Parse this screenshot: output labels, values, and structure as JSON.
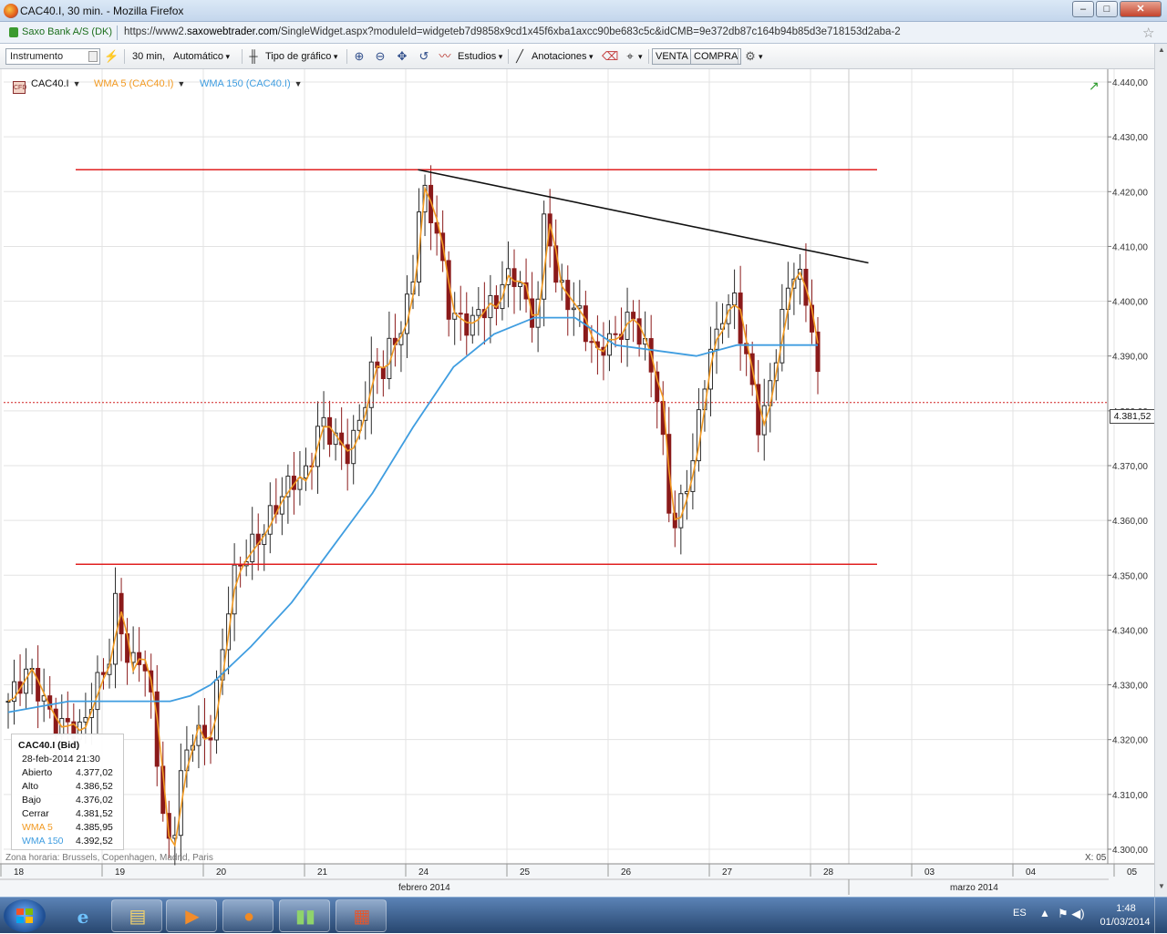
{
  "window": {
    "title": "CAC40.I, 30 min. - Mozilla Firefox",
    "controls": [
      "–",
      "□",
      "✕"
    ]
  },
  "urlbar": {
    "site_identity": "Saxo Bank A/S (DK)",
    "url_prefix": "https://www2.",
    "url_domain": "saxowebtrader.com",
    "url_rest": "/SingleWidget.aspx?moduleId=widgeteb7d9858x9cd1x45f6xba1axcc90be683c5c&idCMB=9e372db87c164b94b85d3e718153d2aba-2"
  },
  "toolbar": {
    "instrument_placeholder": "Instrumento",
    "interval": "30 min",
    "scale": "Automático",
    "chart_type": "Tipo de gráfico",
    "studies": "Estudios",
    "annotations": "Anotaciones",
    "sell": "VENTA",
    "buy": "COMPRA"
  },
  "legend": {
    "instrument": "CAC40.I",
    "wma5": "WMA 5 (CAC40.I)",
    "wma150": "WMA 150 (CAC40.I)",
    "cfd_badge": "CFD"
  },
  "colors": {
    "wma5": "#f29a22",
    "wma150": "#3f9de0",
    "candle_up": "#2b2b2b",
    "candle_down": "#8b1a1a",
    "horizontal_lines": "#e02020",
    "trendline": "#111111",
    "last_price_line": "#d02020"
  },
  "infobox": {
    "title": "CAC40.I (Bid)",
    "datetime": "28-feb-2014  21:30",
    "rows": [
      {
        "label": "Abierto",
        "value": "4.377,02"
      },
      {
        "label": "Alto",
        "value": "4.386,52"
      },
      {
        "label": "Bajo",
        "value": "4.376,02"
      },
      {
        "label": "Cerrar",
        "value": "4.381,52"
      },
      {
        "label": "WMA 5",
        "value": "4.385,95"
      },
      {
        "label": "WMA 150",
        "value": "4.392,52"
      }
    ]
  },
  "timezone": "Zona horaria: Brussels, Copenhagen, Madrid, Paris",
  "xcoord": "X: 05",
  "last_price": "4.381,52",
  "chart_data": {
    "type": "line",
    "instrument": "CAC40.I",
    "interval": "30 min",
    "y_ticks": [
      "4.440,00",
      "4.430,00",
      "4.420,00",
      "4.410,00",
      "4.400,00",
      "4.390,00",
      "4.380,00",
      "4.370,00",
      "4.360,00",
      "4.350,00",
      "4.340,00",
      "4.330,00",
      "4.320,00",
      "4.310,00",
      "4.300,00"
    ],
    "ylim": [
      4297,
      4442
    ],
    "x_day_labels": [
      "18",
      "19",
      "20",
      "21",
      "24",
      "25",
      "26",
      "27",
      "28",
      "03",
      "04",
      "05"
    ],
    "month_labels": [
      "febrero 2014",
      "marzo 2014"
    ],
    "days": [
      {
        "label": "18",
        "start": 0,
        "end": 1
      },
      {
        "label": "19",
        "start": 1,
        "end": 2
      },
      {
        "label": "20",
        "start": 2,
        "end": 3
      },
      {
        "label": "21",
        "start": 3,
        "end": 4
      },
      {
        "label": "24",
        "start": 4,
        "end": 5
      },
      {
        "label": "25",
        "start": 5,
        "end": 6
      },
      {
        "label": "26",
        "start": 6,
        "end": 7
      },
      {
        "label": "27",
        "start": 7,
        "end": 8
      },
      {
        "label": "28",
        "start": 8,
        "end": 9
      },
      {
        "label": "03",
        "start": 9,
        "end": 10
      },
      {
        "label": "04",
        "start": 10,
        "end": 11
      },
      {
        "label": "05",
        "start": 11,
        "end": 12
      }
    ],
    "price_path": [
      [
        0.0,
        4327
      ],
      [
        0.1,
        4330
      ],
      [
        0.2,
        4333
      ],
      [
        0.3,
        4329
      ],
      [
        0.4,
        4325
      ],
      [
        0.5,
        4322
      ],
      [
        0.6,
        4323
      ],
      [
        0.7,
        4321
      ],
      [
        0.8,
        4326
      ],
      [
        0.9,
        4331
      ],
      [
        1.0,
        4335
      ],
      [
        1.05,
        4345
      ],
      [
        1.1,
        4342
      ],
      [
        1.15,
        4338
      ],
      [
        1.2,
        4332
      ],
      [
        1.28,
        4336
      ],
      [
        1.35,
        4333
      ],
      [
        1.42,
        4326
      ],
      [
        1.5,
        4312
      ],
      [
        1.55,
        4302
      ],
      [
        1.6,
        4300
      ],
      [
        1.65,
        4305
      ],
      [
        1.7,
        4313
      ],
      [
        1.78,
        4318
      ],
      [
        1.85,
        4323
      ],
      [
        1.92,
        4319
      ],
      [
        2.0,
        4322
      ],
      [
        2.05,
        4328
      ],
      [
        2.1,
        4334
      ],
      [
        2.15,
        4341
      ],
      [
        2.2,
        4348
      ],
      [
        2.28,
        4352
      ],
      [
        2.36,
        4354
      ],
      [
        2.44,
        4356
      ],
      [
        2.52,
        4358
      ],
      [
        2.6,
        4361
      ],
      [
        2.68,
        4364
      ],
      [
        2.76,
        4366
      ],
      [
        2.84,
        4368
      ],
      [
        2.92,
        4367
      ],
      [
        3.0,
        4372
      ],
      [
        3.05,
        4376
      ],
      [
        3.1,
        4378
      ],
      [
        3.18,
        4376
      ],
      [
        3.26,
        4374
      ],
      [
        3.34,
        4372
      ],
      [
        3.42,
        4375
      ],
      [
        3.5,
        4380
      ],
      [
        3.56,
        4385
      ],
      [
        3.62,
        4389
      ],
      [
        3.7,
        4387
      ],
      [
        3.78,
        4392
      ],
      [
        3.86,
        4394
      ],
      [
        3.92,
        4397
      ],
      [
        4.0,
        4405
      ],
      [
        4.05,
        4415
      ],
      [
        4.08,
        4421
      ],
      [
        4.12,
        4419
      ],
      [
        4.18,
        4416
      ],
      [
        4.24,
        4412
      ],
      [
        4.3,
        4405
      ],
      [
        4.36,
        4398
      ],
      [
        4.42,
        4397
      ],
      [
        4.5,
        4396
      ],
      [
        4.58,
        4396
      ],
      [
        4.66,
        4398
      ],
      [
        4.74,
        4400
      ],
      [
        4.82,
        4398
      ],
      [
        4.88,
        4405
      ],
      [
        4.94,
        4404
      ],
      [
        5.0,
        4403
      ],
      [
        5.06,
        4405
      ],
      [
        5.12,
        4398
      ],
      [
        5.18,
        4396
      ],
      [
        5.24,
        4402
      ],
      [
        5.3,
        4415
      ],
      [
        5.36,
        4411
      ],
      [
        5.42,
        4403
      ],
      [
        5.5,
        4401
      ],
      [
        5.58,
        4399
      ],
      [
        5.66,
        4397
      ],
      [
        5.74,
        4393
      ],
      [
        5.82,
        4390
      ],
      [
        5.9,
        4393
      ],
      [
        6.0,
        4393
      ],
      [
        6.08,
        4396
      ],
      [
        6.16,
        4397
      ],
      [
        6.24,
        4394
      ],
      [
        6.32,
        4390
      ],
      [
        6.38,
        4385
      ],
      [
        6.44,
        4382
      ],
      [
        6.48,
        4371
      ],
      [
        6.52,
        4363
      ],
      [
        6.56,
        4359
      ],
      [
        6.62,
        4361
      ],
      [
        6.7,
        4366
      ],
      [
        6.78,
        4373
      ],
      [
        6.84,
        4380
      ],
      [
        6.9,
        4388
      ],
      [
        6.96,
        4393
      ],
      [
        7.0,
        4393
      ],
      [
        7.06,
        4398
      ],
      [
        7.12,
        4399
      ],
      [
        7.18,
        4400
      ],
      [
        7.24,
        4394
      ],
      [
        7.3,
        4389
      ],
      [
        7.36,
        4383
      ],
      [
        7.42,
        4377
      ],
      [
        7.48,
        4380
      ],
      [
        7.56,
        4388
      ],
      [
        7.64,
        4396
      ],
      [
        7.7,
        4402
      ],
      [
        7.76,
        4406
      ],
      [
        7.82,
        4404
      ],
      [
        7.88,
        4400
      ],
      [
        7.94,
        4396
      ],
      [
        8.0,
        4385
      ]
    ],
    "wma150_path": [
      [
        0.0,
        4325
      ],
      [
        0.6,
        4327
      ],
      [
        1.0,
        4327
      ],
      [
        1.3,
        4327
      ],
      [
        1.6,
        4327
      ],
      [
        1.8,
        4328
      ],
      [
        2.0,
        4330
      ],
      [
        2.4,
        4337
      ],
      [
        2.8,
        4345
      ],
      [
        3.2,
        4355
      ],
      [
        3.6,
        4365
      ],
      [
        4.0,
        4377
      ],
      [
        4.4,
        4388
      ],
      [
        4.8,
        4394
      ],
      [
        5.2,
        4397
      ],
      [
        5.6,
        4397
      ],
      [
        6.0,
        4392
      ],
      [
        6.4,
        4391
      ],
      [
        6.8,
        4390
      ],
      [
        7.2,
        4392
      ],
      [
        7.6,
        4392
      ],
      [
        7.8,
        4392
      ],
      [
        8.0,
        4392
      ]
    ],
    "resistance": 4424,
    "support": 4352,
    "trendline": [
      [
        4.05,
        4424
      ],
      [
        8.5,
        4407
      ]
    ],
    "last_value": 4381.52
  }
}
